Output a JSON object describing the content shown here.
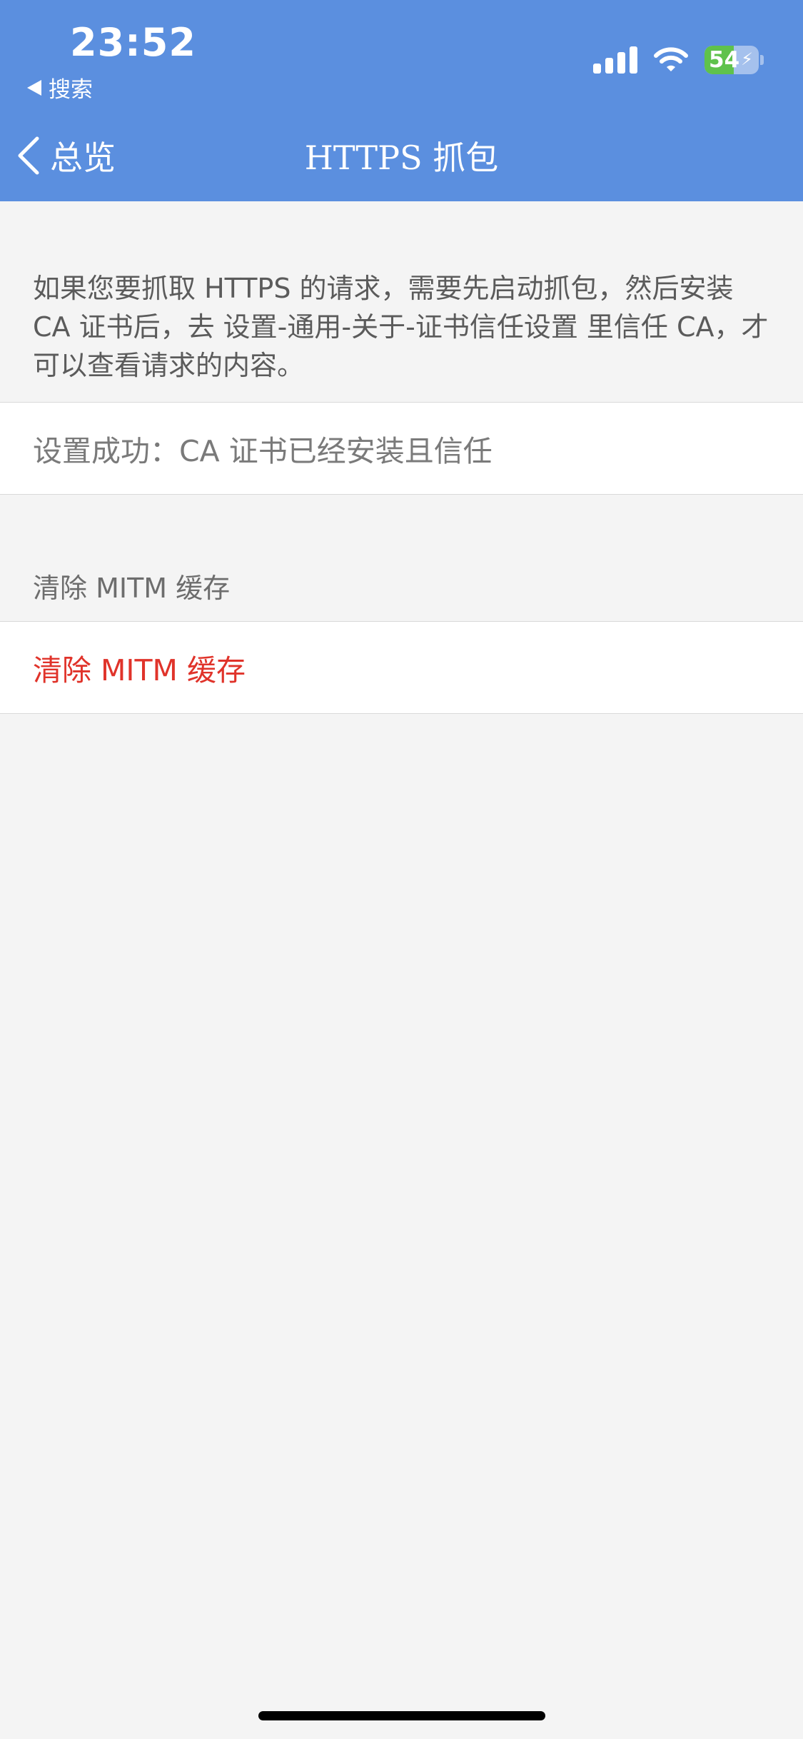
{
  "status_bar": {
    "time": "23:52",
    "back_app_label": "搜索",
    "battery_percent": "54",
    "battery_level": 0.54,
    "charging_icon": "⚡"
  },
  "nav": {
    "back_label": "总览",
    "title": "HTTPS 抓包"
  },
  "content": {
    "description": "如果您要抓取 HTTPS 的请求，需要先启动抓包，然后安装 CA 证书后，去 设置-通用-关于-证书信任设置 里信任 CA，才可以查看请求的内容。",
    "ca_status": "设置成功：CA 证书已经安装且信任",
    "mitm_section_header": "清除 MITM 缓存",
    "clear_mitm_label": "清除 MITM 缓存"
  },
  "colors": {
    "header_bg": "#5b8fdf",
    "destructive": "#e0332a",
    "battery_green": "#5fc24c"
  },
  "icons": {
    "signal": "cellular-signal-icon",
    "wifi": "wifi-icon",
    "battery": "battery-icon",
    "back": "chevron-left-icon"
  }
}
